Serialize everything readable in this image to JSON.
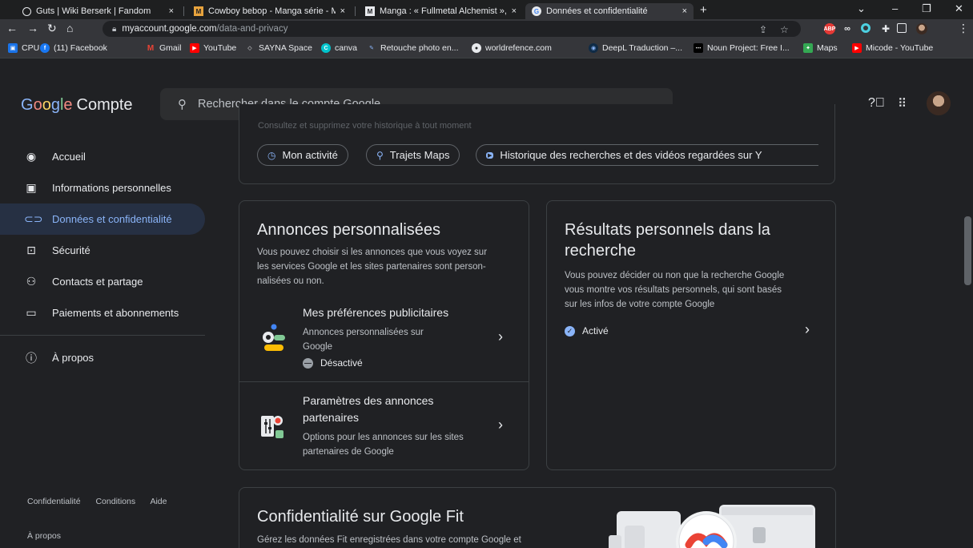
{
  "browser": {
    "tabs": [
      {
        "title": "Guts | Wiki Berserk | Fandom",
        "icon": "globe-icon"
      },
      {
        "title": "Cowboy bebop - Manga série - M",
        "icon": "manga-site-icon"
      },
      {
        "title": "Manga : « Fullmetal Alchemist », l",
        "icon": "manga-site-icon"
      },
      {
        "title": "Données et confidentialité",
        "icon": "google-icon"
      }
    ],
    "tab_close": "×",
    "new_tab": "+",
    "window": {
      "min": "–",
      "restore": "❐",
      "close": "✕",
      "tab_search": "⌄"
    },
    "url_host": "myaccount.google.com",
    "url_path": "/data-and-privacy",
    "extensions": [
      "ABP"
    ],
    "bookmarks": [
      "CPU",
      "(11) Facebook",
      "Gmail",
      "YouTube",
      "SAYNA Space",
      "canva",
      "Retouche photo en...",
      "worldrefence.com",
      "DeepL Traduction –...",
      "Noun Project: Free I...",
      "Maps",
      "Micode - YouTube"
    ]
  },
  "header": {
    "logo_google": [
      "G",
      "o",
      "o",
      "g",
      "l",
      "e"
    ],
    "logo_compte": "Compte",
    "search_placeholder": "Rechercher dans le compte Google"
  },
  "sidebar": {
    "items": [
      {
        "label": "Accueil",
        "icon": "account-circle-icon",
        "active": false
      },
      {
        "label": "Informations personnelles",
        "icon": "id-card-icon",
        "active": false
      },
      {
        "label": "Données et confidentialité",
        "icon": "toggle-icon",
        "active": true
      },
      {
        "label": "Sécurité",
        "icon": "lock-icon",
        "active": false
      },
      {
        "label": "Contacts et partage",
        "icon": "people-icon",
        "active": false
      },
      {
        "label": "Paiements et abonnements",
        "icon": "credit-card-icon",
        "active": false
      }
    ],
    "about": "À propos",
    "footer_links": [
      "Confidentialité",
      "Conditions",
      "Aide"
    ],
    "footer_about": "À propos"
  },
  "history": {
    "ghost_text": "Consultez et supprimez votre historique à tout moment",
    "chips": [
      "Mon activité",
      "Trajets Maps",
      "Historique des recherches et des vidéos regardées sur Y"
    ]
  },
  "ads_card": {
    "title": "Annonces personnalisées",
    "description": [
      "Vous pouvez choisir si les annonces que vous voyez sur",
      "les services Google et les sites partenaires sont person-",
      "nalisées ou non."
    ],
    "row1": {
      "title": "Mes préférences publicitaires",
      "subtitle": [
        "Annonces personnalisées sur",
        "Google"
      ],
      "status": "Désactivé"
    },
    "row2": {
      "title": [
        "Paramètres des annonces",
        "partenaires"
      ],
      "subtitle": [
        "Options pour les annonces sur les sites",
        "partenaires de Google"
      ]
    }
  },
  "search_card": {
    "title": [
      "Résultats personnels dans la",
      "recherche"
    ],
    "description": [
      "Vous pouvez décider ou non que la recherche Google",
      "vous montre vos résultats personnels, qui sont basés",
      "sur les infos de votre compte Google"
    ],
    "status": "Activé"
  },
  "fit_card": {
    "title": "Confidentialité sur Google Fit",
    "description": "Gérez les données Fit enregistrées dans votre compte Google et"
  },
  "colors": {
    "accent": "#8ab4f8",
    "active_bg": "#263043",
    "status_on": "#8ab4f8",
    "status_off": "#9aa0a6"
  }
}
